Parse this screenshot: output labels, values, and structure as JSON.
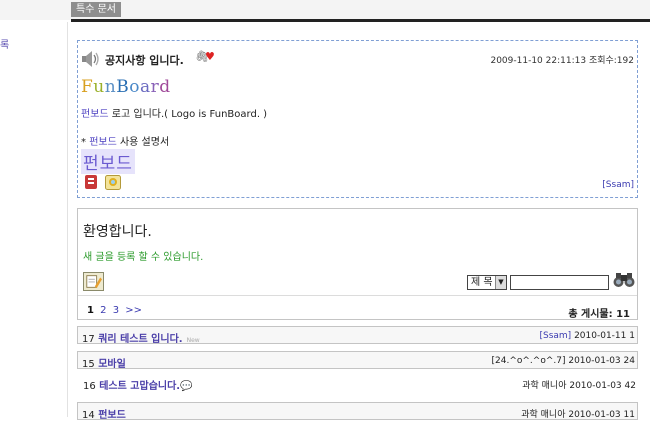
{
  "top_tab": "특수 문서",
  "left_nav": {
    "link_fragment": "록"
  },
  "notice": {
    "title": "공지사항 입니다.",
    "date": "2009-11-10 22:11:13",
    "views_label": "조회수:192",
    "logo_text": "FunBoard",
    "line1_highlight": "펀보드",
    "line1_rest": " 로고 입니다.( Logo is FunBoard. )",
    "line2_prefix": "* ",
    "line2_highlight": "펀보드",
    "line2_rest": " 사용 설명서",
    "big_text": "펀보드",
    "author": "[Ssam]"
  },
  "welcome": {
    "title": "환영합니다.",
    "subtitle": "새 글을 등록 할 수 있습니다.",
    "search_select": "제 목",
    "search_value": "",
    "pages": [
      "1",
      "2",
      "3",
      ">>"
    ],
    "total": "총 게시물: 11"
  },
  "posts": [
    {
      "num": "17",
      "title": "쿼리 테스트 입니다.",
      "badge": "New",
      "author": "[Ssam]",
      "date": "2010-01-11",
      "count": "1"
    },
    {
      "num": "15",
      "title": "모바일",
      "badge": "",
      "author": "[24.^o^.^o^.7]",
      "date": "2010-01-03",
      "count": "24"
    },
    {
      "num": "16",
      "title": "테스트 고맙습니다.",
      "badge": "",
      "author": "과학 매니아",
      "date": "2010-01-03",
      "count": "42"
    },
    {
      "num": "14",
      "title": "펀보드",
      "badge": "",
      "author": "과학 매니아",
      "date": "2010-01-03",
      "count": "11"
    }
  ],
  "colors": {
    "accent": "#4a3ea8",
    "green": "#2a9a2a",
    "border_dashed": "#7f9fd4"
  },
  "icons": {
    "speaker": "speaker-icon",
    "clip": "paperclip-icon",
    "heart": "heart-icon",
    "write": "write-icon",
    "search": "binoculars-icon"
  }
}
